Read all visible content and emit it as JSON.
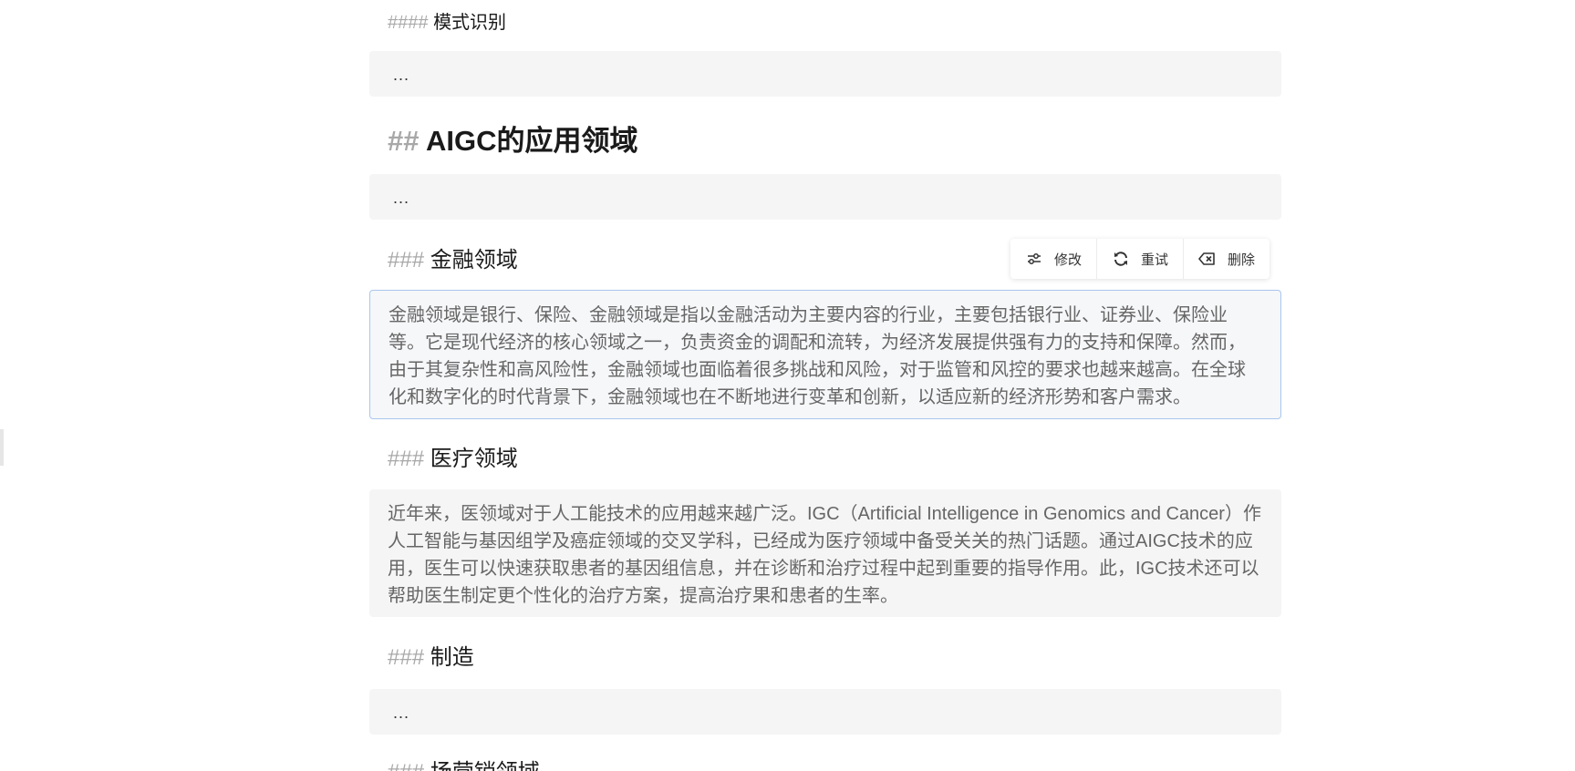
{
  "doc": {
    "h4_mode": {
      "hash": "####",
      "title": "模式识别"
    },
    "block1": {
      "text": "..."
    },
    "h2_app": {
      "hash": "##",
      "title": "AIGC的应用领域"
    },
    "block2": {
      "text": "..."
    },
    "h3_finance": {
      "hash": "###",
      "title": "金融领域"
    },
    "finance_para": "金融领域是银行、保险、金融领域是指以金融活动为主要内容的行业，主要包括银行业、证券业、保险业等。它是现代经济的核心领域之一，负责资金的调配和流转，为经济发展提供强有力的支持和保障。然而，由于其复杂性和高风险性，金融领域也面临着很多挑战和风险，对于监管和风控的要求也越来越高。在全球化和数字化的时代背景下，金融领域也在不断地进行变革和创新，以适应新的经济形势和客户需求。",
    "h3_medical": {
      "hash": "###",
      "title": "医疗领域"
    },
    "medical_para": "近年来，医领域对于人工能技术的应用越来越广泛。IGC（Artificial Intelligence in Genomics and Cancer）作人工智能与基因组学及癌症领域的交叉学科，已经成为医疗领域中备受关关的热门话题。通过AIGC技术的应用，医生可以快速获取患者的基因组信息，并在诊断和治疗过程中起到重要的指导作用。此，IGC技术还可以帮助医生制定更个性化的治疗方案，提高治疗果和患者的生率。",
    "h3_manufacturing": {
      "hash": "###",
      "title": "制造"
    },
    "block3": {
      "text": "..."
    },
    "h3_marketing": {
      "hash": "###",
      "title": "场营销领域"
    }
  },
  "toolbar": {
    "edit_label": "修改",
    "edit_icon": "sliders-icon",
    "retry_label": "重试",
    "retry_icon": "refresh-icon",
    "delete_label": "删除",
    "delete_icon": "backspace-icon"
  },
  "colors": {
    "hash": "#a8a8a8",
    "block_bg": "#f5f5f5",
    "selected_border": "#a9c6ee",
    "para_text": "#666666"
  }
}
